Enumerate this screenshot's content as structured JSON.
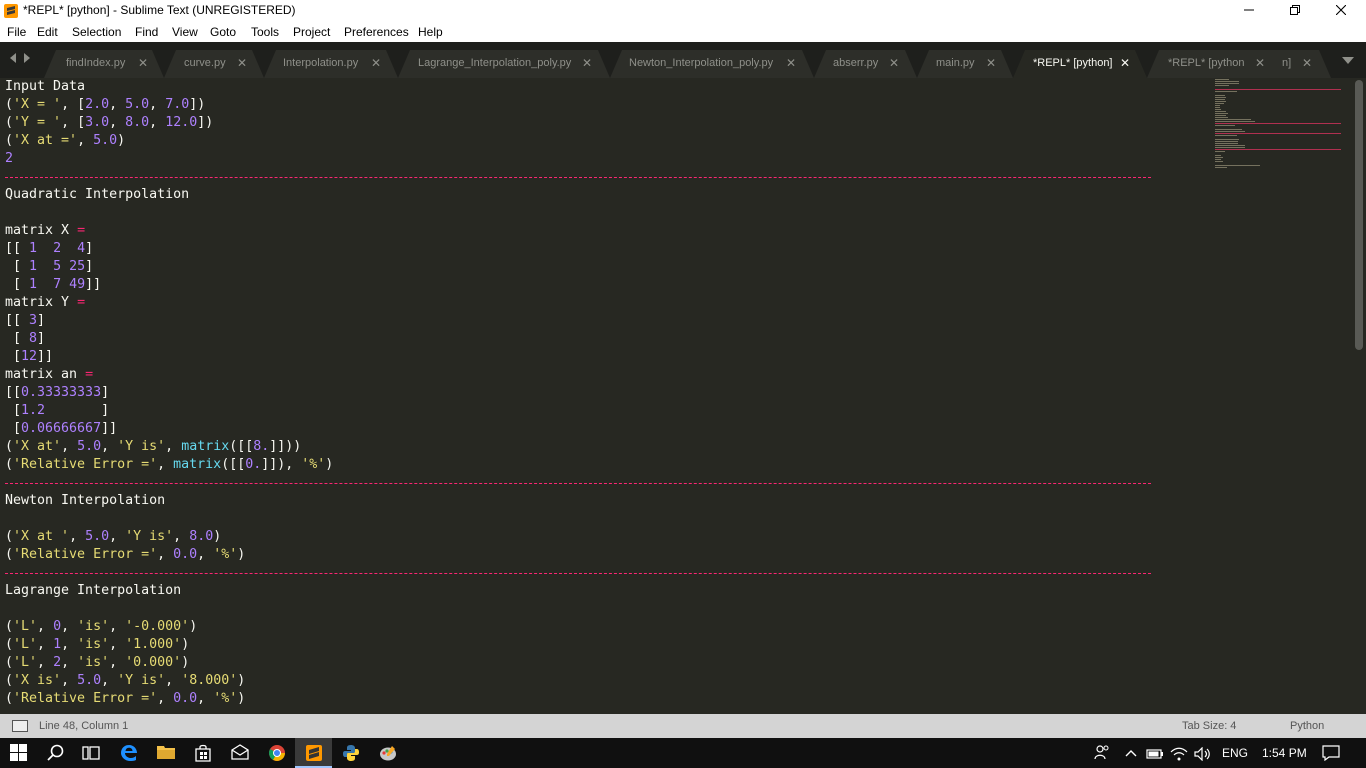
{
  "window": {
    "title": "*REPL* [python] - Sublime Text (UNREGISTERED)"
  },
  "menu": {
    "items": [
      "File",
      "Edit",
      "Selection",
      "Find",
      "View",
      "Goto",
      "Tools",
      "Project",
      "Preferences",
      "Help"
    ]
  },
  "tabs": [
    {
      "label": "findIndex.py",
      "active": false
    },
    {
      "label": "curve.py",
      "active": false
    },
    {
      "label": "Interpolation.py",
      "active": false
    },
    {
      "label": "Lagrange_Interpolation_poly.py",
      "active": false
    },
    {
      "label": "Newton_Interpolation_poly.py",
      "active": false
    },
    {
      "label": "abserr.py",
      "active": false
    },
    {
      "label": "main.py",
      "active": false
    },
    {
      "label": "*REPL* [python]",
      "active": true
    },
    {
      "label": "*REPL* [python",
      "active": false
    },
    {
      "label": "n]",
      "active": false
    }
  ],
  "editor": {
    "lines": [
      "Input Data",
      "('X = ', [2.0, 5.0, 7.0])",
      "('Y = ', [3.0, 8.0, 12.0])",
      "('X at =', 5.0)",
      "2",
      "",
      "Quadratic Interpolation",
      "",
      "matrix X =",
      "[[ 1  2  4]",
      " [ 1  5 25]",
      " [ 1  7 49]]",
      "matrix Y =",
      "[[ 3]",
      " [ 8]",
      " [12]]",
      "matrix an =",
      "[[0.33333333]",
      " [1.2       ]",
      " [0.06666667]]",
      "('X at', 5.0, 'Y is', matrix([[8.]]))",
      "('Relative Error =', matrix([[0.]]), '%')",
      "",
      "Newton Interpolation",
      "",
      "('X at ', 5.0, 'Y is', 8.0)",
      "('Relative Error =', 0.0, '%')",
      "",
      "Lagrange Interpolation",
      "",
      "('L', 0, 'is', '-0.000')",
      "('L', 1, 'is', '1.000')",
      "('L', 2, 'is', '0.000')",
      "('X is', 5.0, 'Y is', '8.000')",
      "('Relative Error =', 0.0, '%')"
    ]
  },
  "statusbar": {
    "position": "Line 48, Column 1",
    "tab_size": "Tab Size: 4",
    "syntax": "Python"
  },
  "taskbar": {
    "language": "ENG",
    "time": "1:54 PM"
  },
  "colors": {
    "editor_bg": "#272822",
    "string": "#e6db74",
    "number": "#ae81ff",
    "keyword": "#f92672",
    "builtin": "#66d9ef",
    "text": "#f8f8f2"
  }
}
